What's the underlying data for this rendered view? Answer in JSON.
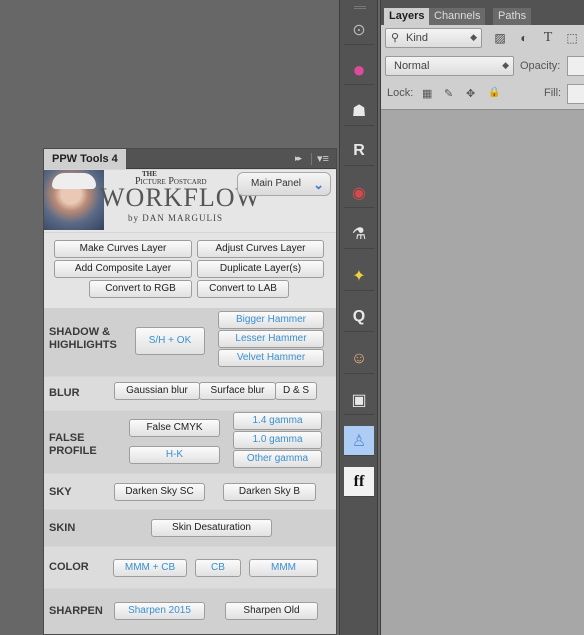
{
  "ppw": {
    "title": "PPW Tools 4",
    "collapse_glyph": "▸▸",
    "menu_glyph": "▾≡",
    "logo": {
      "the": "THE",
      "picture_postcard": "Picture Postcard",
      "workflow": "WORKFLOW",
      "byline": "by DAN MARGULIS"
    },
    "panel_dropdown": {
      "value": "Main Panel",
      "icon": "chevron-down-icon",
      "glyph": "⌄"
    },
    "top_buttons": [
      {
        "label": "Make Curves Layer"
      },
      {
        "label": "Adjust Curves Layer"
      },
      {
        "label": "Add Composite Layer"
      },
      {
        "label": "Duplicate Layer(s)"
      },
      {
        "label": "Convert to RGB"
      },
      {
        "label": "Convert to LAB"
      }
    ],
    "sections": {
      "shadow_highlights": {
        "label": "SHADOW &\nHIGHLIGHTS",
        "sh_ok": "S/H + OK",
        "bigger": "Bigger Hammer",
        "lesser": "Lesser Hammer",
        "velvet": "Velvet Hammer"
      },
      "blur": {
        "label": "BLUR",
        "gaussian": "Gaussian blur",
        "surface": "Surface blur",
        "ds": "D & S"
      },
      "false_profile": {
        "label": "FALSE\nPROFILE",
        "false_cmyk": "False CMYK",
        "hk": "H-K",
        "g14": "1.4 gamma",
        "g10": "1.0 gamma",
        "other": "Other gamma"
      },
      "sky": {
        "label": "SKY",
        "sc": "Darken Sky SC",
        "b": "Darken Sky B"
      },
      "skin": {
        "label": "SKIN",
        "desat": "Skin Desaturation"
      },
      "color": {
        "label": "COLOR",
        "mmmcb": "MMM + CB",
        "cb": "CB",
        "mmm": "MMM"
      },
      "sharpen": {
        "label": "SHARPEN",
        "s2015": "Sharpen 2015",
        "old": "Sharpen Old"
      }
    }
  },
  "toolstrip": [
    {
      "icon": "color-sampler-icon",
      "glyph": "⊙"
    },
    {
      "icon": "cmyk-swatch-icon",
      "glyph": "●"
    },
    {
      "icon": "mask-icon",
      "glyph": "☗"
    },
    {
      "icon": "script-r-icon",
      "glyph": "R"
    },
    {
      "icon": "disc-icon",
      "glyph": "◉"
    },
    {
      "icon": "flask-icon",
      "glyph": "⚗"
    },
    {
      "icon": "magic-wand-icon",
      "glyph": "✦"
    },
    {
      "icon": "lasso-q-icon",
      "glyph": "Q"
    },
    {
      "icon": "portrait-icon",
      "glyph": "☺"
    },
    {
      "icon": "briefcase-icon",
      "glyph": "▣"
    },
    {
      "icon": "figure-icon",
      "glyph": "♙"
    },
    {
      "icon": "ff-logo-icon",
      "glyph": "ff"
    }
  ],
  "layers": {
    "tabs": [
      {
        "label": "Layers"
      },
      {
        "label": "Channels"
      },
      {
        "label": "Paths"
      }
    ],
    "kind": {
      "value": "Kind",
      "icon": "search-icon"
    },
    "filters": [
      {
        "icon": "image-filter-icon",
        "glyph": "▨"
      },
      {
        "icon": "adjustment-filter-icon",
        "glyph": "◐"
      },
      {
        "icon": "type-filter-icon",
        "glyph": "T"
      },
      {
        "icon": "shape-filter-icon",
        "glyph": "⬚"
      }
    ],
    "blend_mode": "Normal",
    "opacity_label": "Opacity:",
    "lock_label": "Lock:",
    "fill_label": "Fill:",
    "lock_icons": [
      {
        "icon": "lock-transparent-icon",
        "glyph": "▦"
      },
      {
        "icon": "lock-brush-icon",
        "glyph": "✎"
      },
      {
        "icon": "lock-move-icon",
        "glyph": "✥"
      },
      {
        "icon": "lock-all-icon",
        "glyph": "🔒"
      }
    ]
  }
}
